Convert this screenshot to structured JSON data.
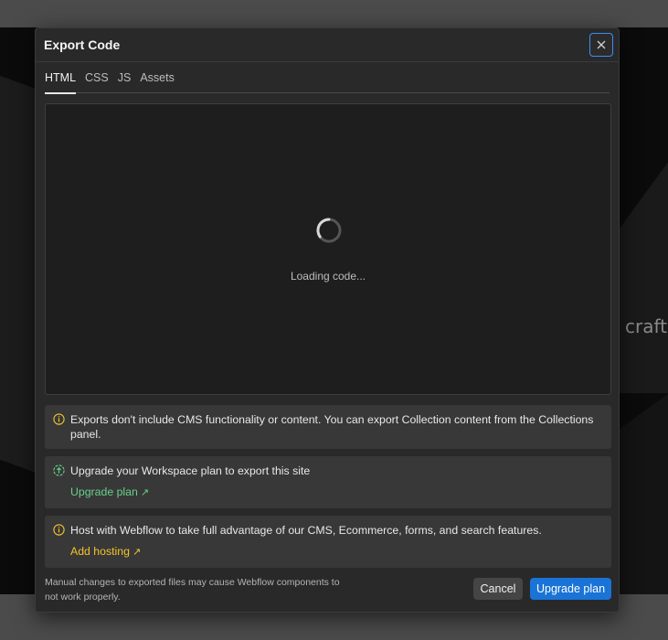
{
  "background": {
    "partial_text": "craft"
  },
  "modal": {
    "title": "Export Code",
    "close_icon": "close-icon",
    "tabs": [
      {
        "label": "HTML",
        "active": true
      },
      {
        "label": "CSS",
        "active": false
      },
      {
        "label": "JS",
        "active": false
      },
      {
        "label": "Assets",
        "active": false
      }
    ],
    "code_area": {
      "loading_text": "Loading code..."
    },
    "notices": [
      {
        "icon": "info-icon",
        "text": "Exports don't include CMS functionality or content. You can export Collection content from the Collections panel."
      },
      {
        "icon": "upgrade-icon",
        "text": "Upgrade your Workspace plan to export this site",
        "link": "Upgrade plan",
        "link_color": "#67d18a"
      },
      {
        "icon": "info-icon",
        "text": "Host with Webflow to take full advantage of our CMS, Ecommerce, forms, and search features.",
        "link": "Add hosting",
        "link_color": "#f5c32e"
      }
    ],
    "footer_note": "Manual changes to exported files may cause Webflow components to not work properly.",
    "cancel_label": "Cancel",
    "upgrade_label": "Upgrade plan",
    "accent_color": "#1a73d6"
  }
}
